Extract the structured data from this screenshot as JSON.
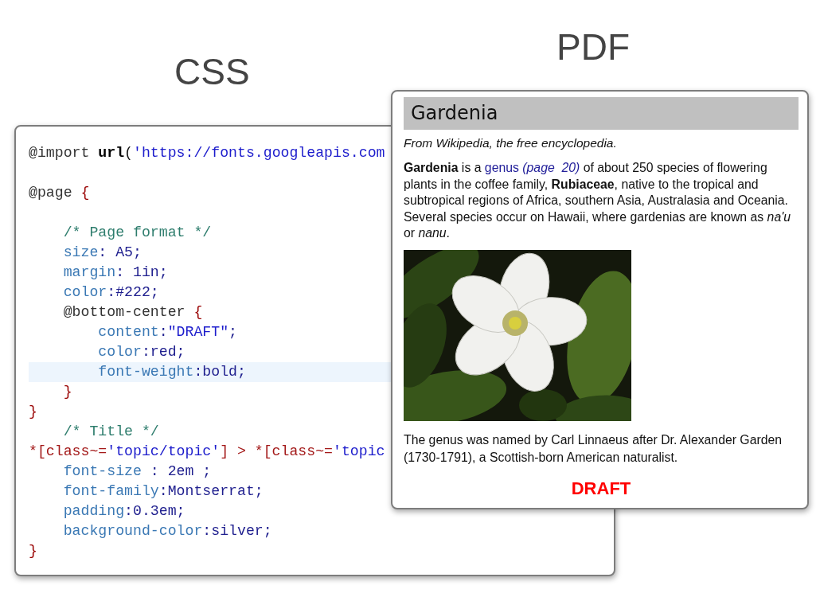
{
  "headings": [
    {
      "text": "CSS"
    },
    {
      "text": "PDF"
    }
  ],
  "code": {
    "lines": [
      {
        "highlighted": false,
        "tokens": [
          {
            "kind": "at-rule",
            "text": "@import "
          },
          {
            "kind": "function",
            "text": "url"
          },
          {
            "kind": "punct",
            "text": "("
          },
          {
            "kind": "string",
            "text": "'https://fonts.googleapis.com"
          }
        ]
      },
      {
        "highlighted": false
      },
      {
        "highlighted": false,
        "tokens": [
          {
            "kind": "at-rule",
            "text": "@page "
          },
          {
            "kind": "brace",
            "text": "{"
          }
        ]
      },
      {
        "highlighted": false
      },
      {
        "highlighted": false,
        "tokens": [
          {
            "kind": "comment",
            "text": "    /* Page format */"
          }
        ]
      },
      {
        "highlighted": false,
        "tokens": [
          {
            "kind": "property",
            "text": "    size"
          },
          {
            "kind": "value",
            "text": ": A5;"
          }
        ]
      },
      {
        "highlighted": false,
        "tokens": [
          {
            "kind": "property",
            "text": "    margin"
          },
          {
            "kind": "value",
            "text": ": 1in;"
          }
        ]
      },
      {
        "highlighted": false,
        "tokens": [
          {
            "kind": "property",
            "text": "    color"
          },
          {
            "kind": "value",
            "text": ":#222;"
          }
        ]
      },
      {
        "highlighted": false,
        "tokens": [
          {
            "kind": "at-rule",
            "text": "    @bottom-center "
          },
          {
            "kind": "brace",
            "text": "{"
          }
        ]
      },
      {
        "highlighted": false,
        "tokens": [
          {
            "kind": "property",
            "text": "        content"
          },
          {
            "kind": "value",
            "text": ":"
          },
          {
            "kind": "string",
            "text": "\"DRAFT\""
          },
          {
            "kind": "value",
            "text": ";"
          }
        ]
      },
      {
        "highlighted": false,
        "tokens": [
          {
            "kind": "property",
            "text": "        color"
          },
          {
            "kind": "value",
            "text": ":red;"
          }
        ]
      },
      {
        "highlighted": true,
        "tokens": [
          {
            "kind": "property",
            "text": "        font-weight"
          },
          {
            "kind": "value",
            "text": ":bold;"
          }
        ]
      },
      {
        "highlighted": false,
        "tokens": [
          {
            "kind": "brace",
            "text": "    }"
          }
        ]
      },
      {
        "highlighted": false,
        "tokens": [
          {
            "kind": "brace",
            "text": "}"
          }
        ]
      },
      {
        "highlighted": false,
        "tokens": [
          {
            "kind": "comment",
            "text": "    /* Title */"
          }
        ]
      },
      {
        "highlighted": false,
        "tokens": [
          {
            "kind": "selector",
            "text": "*[class~="
          },
          {
            "kind": "string",
            "text": "'topic/topic'"
          },
          {
            "kind": "selector",
            "text": "] > *[class~="
          },
          {
            "kind": "string",
            "text": "'topic"
          }
        ]
      },
      {
        "highlighted": false,
        "tokens": [
          {
            "kind": "property",
            "text": "    font-size"
          },
          {
            "kind": "value",
            "text": " : 2em ;"
          }
        ]
      },
      {
        "highlighted": false,
        "tokens": [
          {
            "kind": "property",
            "text": "    font-family"
          },
          {
            "kind": "value",
            "text": ":Montserrat;"
          }
        ]
      },
      {
        "highlighted": false,
        "tokens": [
          {
            "kind": "property",
            "text": "    padding"
          },
          {
            "kind": "value",
            "text": ":0.3em;"
          }
        ]
      },
      {
        "highlighted": false,
        "tokens": [
          {
            "kind": "property",
            "text": "    background-color"
          },
          {
            "kind": "value",
            "text": ":silver;"
          }
        ]
      },
      {
        "highlighted": false,
        "tokens": [
          {
            "kind": "brace",
            "text": "}"
          }
        ]
      }
    ]
  },
  "pdf": {
    "title": "Gardenia",
    "subtitle": "From Wikipedia, the free encyclopedia.",
    "intro": {
      "before": "**Gardenia** is a ",
      "link": "genus",
      "page_ref": "(page  20)",
      "after": " of about 250 species of flowering plants in the coffee family, **Rubiaceae**, native to the tropical and subtropical regions of Africa, southern Asia, Australasia and Oceania. Several species occur on Hawaii, where gardenias are known as *na'u* or *nanu*."
    },
    "caption": "The genus was named by Carl Linnaeus after Dr. Alexander Garden (1730-1791), a Scottish-born American naturalist.",
    "footer": "DRAFT"
  }
}
